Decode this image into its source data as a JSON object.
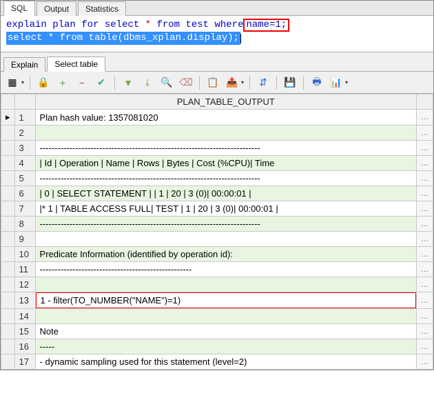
{
  "top_tabs": {
    "sql": "SQL",
    "output": "Output",
    "statistics": "Statistics"
  },
  "sql_editor": {
    "line1_prefix": "explain plan for select ",
    "line1_star": "*",
    "line1_mid": " from test where",
    "line1_box": " name=1;",
    "line2": "select * from table(dbms_xplan.display);"
  },
  "result_tabs": {
    "explain": "Explain",
    "select_table": "Select table"
  },
  "toolbar": {
    "grid": "▦",
    "lock": "🔒",
    "plus": "+",
    "minus": "−",
    "check": "✔",
    "down1": "▼",
    "down2": "⤓",
    "binoculars": "🔍",
    "eraser": "⌫",
    "copy": "📋",
    "export": "📤",
    "tree": "⇵",
    "save": "💾",
    "print": "🖶",
    "chart": "📊"
  },
  "grid": {
    "header": "PLAN_TABLE_OUTPUT",
    "rows": [
      "Plan hash value: 1357081020",
      "",
      "--------------------------------------------------------------------------",
      "| Id  | Operation         | Name | Rows  | Bytes | Cost (%CPU)| Time",
      "--------------------------------------------------------------------------",
      "|   0 | SELECT STATEMENT  |      |     1 |    20 |     3   (0)| 00:00:01 |",
      "|*  1 |  TABLE ACCESS FULL| TEST |     1 |    20 |     3   (0)| 00:00:01 |",
      "--------------------------------------------------------------------------",
      "",
      "Predicate Information (identified by operation id):",
      "---------------------------------------------------",
      "",
      "   1 - filter(TO_NUMBER(\"NAME\")=1)",
      "",
      "Note",
      "-----",
      "   - dynamic sampling used for this statement (level=2)"
    ]
  },
  "ellipsis": "…"
}
